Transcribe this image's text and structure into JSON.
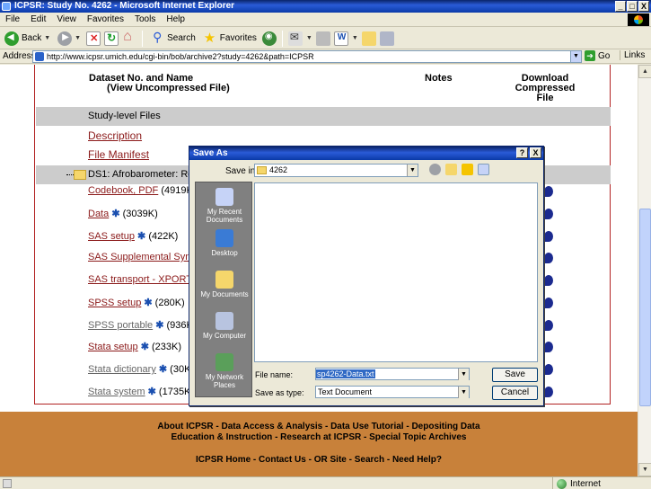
{
  "window": {
    "title": "ICPSR: Study No. 4262 - Microsoft Internet Explorer",
    "controls": [
      "_",
      "□",
      "X"
    ]
  },
  "menu": [
    "File",
    "Edit",
    "View",
    "Favorites",
    "Tools",
    "Help"
  ],
  "toolbar": {
    "back_label": "Back",
    "search_label": "Search",
    "favorites_label": "Favorites"
  },
  "address": {
    "label": "Address",
    "url": "http://www.icpsr.umich.edu/cgi-bin/bob/archive2?study=4262&path=ICPSR",
    "go_label": "Go",
    "links_label": "Links"
  },
  "table": {
    "col_dataset": "Dataset No. and Name",
    "col_dataset_sub": "(View Uncompressed File)",
    "col_notes": "Notes",
    "col_download_1": "Download",
    "col_download_2": "Compressed",
    "col_download_3": "File",
    "study_level": "Study-level Files",
    "description": "Description",
    "file_manifest": "File Manifest",
    "ds1": "DS1: Afrobarometer: Rou",
    "rows": [
      {
        "link": "Codebook, PDF",
        "size": "(4919K)",
        "star": false
      },
      {
        "link": "Data",
        "size": "(3039K)",
        "star": true
      },
      {
        "link": "SAS setup",
        "size": "(422K)",
        "star": true
      },
      {
        "link": "SAS Supplemental Synta",
        "size": "",
        "star": false
      },
      {
        "link": "SAS transport - XPORT e",
        "size": "",
        "star": false
      },
      {
        "link": "SPSS setup",
        "size": "(280K)",
        "star": true
      },
      {
        "link": "SPSS portable",
        "size": "(936K)",
        "star": true
      },
      {
        "link": "Stata setup",
        "size": "(233K)",
        "star": true
      },
      {
        "link": "Stata dictionary",
        "size": "(30K)",
        "star": true
      },
      {
        "link": "Stata system",
        "size": "(1735K)",
        "star": true
      }
    ]
  },
  "footer": {
    "line1": "About ICPSR - Data Access & Analysis - Data Use Tutorial - Depositing Data",
    "line2": "Education & Instruction - Research at ICPSR - Special Topic Archives",
    "line3": "ICPSR Home - Contact Us - OR Site - Search - Need Help?"
  },
  "status": {
    "zone": "Internet"
  },
  "dialog": {
    "title": "Save As",
    "help_btn": "?",
    "close_btn": "X",
    "save_in_label": "Save in:",
    "save_in_value": "4262",
    "places": [
      "My Recent Documents",
      "Desktop",
      "My Documents",
      "My Computer",
      "My Network Places"
    ],
    "file_name_label": "File name:",
    "file_name_value": "sp4262-Data.txt",
    "save_as_type_label": "Save as type:",
    "save_as_type_value": "Text Document",
    "save_btn": "Save",
    "cancel_btn": "Cancel"
  }
}
